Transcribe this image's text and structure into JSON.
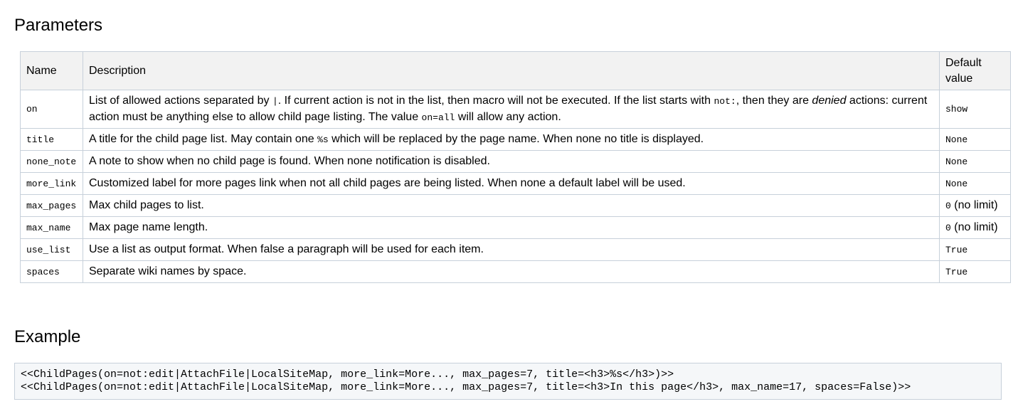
{
  "headings": {
    "parameters": "Parameters",
    "example": "Example"
  },
  "table": {
    "headers": {
      "name": "Name",
      "description": "Description",
      "default_line1": "Default",
      "default_line2": "value"
    },
    "rows": [
      {
        "name": "on",
        "desc": {
          "p1": "List of allowed actions separated by ",
          "c1": "|",
          "p2": ". If current action is not in the list, then macro will not be executed. If the list starts with ",
          "c2": "not:",
          "p3": ", then they are ",
          "em": "denied",
          "p4": " actions: current action must be anything else to allow child page listing. The value ",
          "c3": "on=all",
          "p5": " will allow any action."
        },
        "default_code": "show",
        "default_text": ""
      },
      {
        "name": "title",
        "desc": {
          "p1": "A title for the child page list. May contain one ",
          "c1": "%s",
          "p2": " which will be replaced by the page name. When none no title is displayed."
        },
        "default_code": "None",
        "default_text": ""
      },
      {
        "name": "none_note",
        "desc": {
          "p1": "A note to show when no child page is found. When none notification is disabled."
        },
        "default_code": "None",
        "default_text": ""
      },
      {
        "name": "more_link",
        "desc": {
          "p1": "Customized label for more pages link when not all child pages are being listed. When none a default label will be used."
        },
        "default_code": "None",
        "default_text": ""
      },
      {
        "name": "max_pages",
        "desc": {
          "p1": "Max child pages to list."
        },
        "default_code": "0",
        "default_text": " (no limit)"
      },
      {
        "name": "max_name",
        "desc": {
          "p1": "Max page name length."
        },
        "default_code": "0",
        "default_text": " (no limit)"
      },
      {
        "name": "use_list",
        "desc": {
          "p1": "Use a list as output format. When false a paragraph will be used for each item."
        },
        "default_code": "True",
        "default_text": ""
      },
      {
        "name": "spaces",
        "desc": {
          "p1": "Separate wiki names by space."
        },
        "default_code": "True",
        "default_text": ""
      }
    ]
  },
  "example": {
    "line1": "<<ChildPages(on=not:edit|AttachFile|LocalSiteMap, more_link=More..., max_pages=7, title=<h3>%s</h3>)>>",
    "line2": "<<ChildPages(on=not:edit|AttachFile|LocalSiteMap, more_link=More..., max_pages=7, title=<h3>In this page</h3>, max_name=17, spaces=False)>>"
  }
}
